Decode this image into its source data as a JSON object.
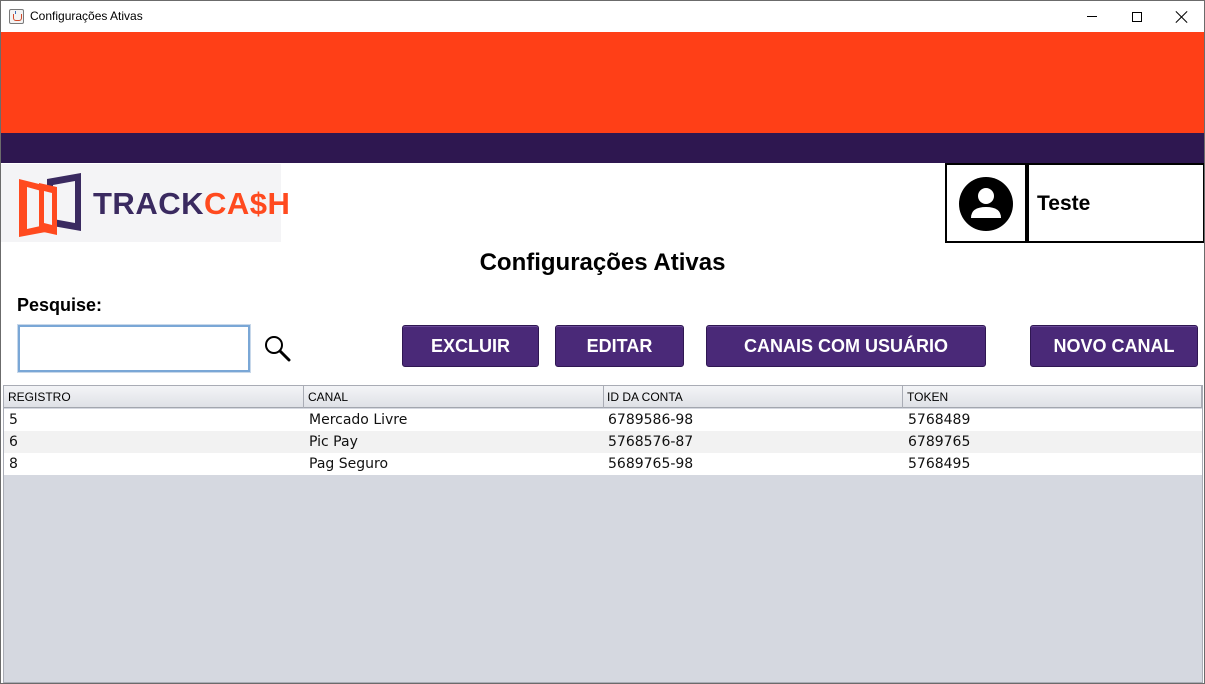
{
  "window": {
    "title": "Configurações Ativas"
  },
  "logo": {
    "text_track": "TRACK",
    "text_cash": "CA$H"
  },
  "user": {
    "name": "Teste"
  },
  "page": {
    "title": "Configurações Ativas"
  },
  "search": {
    "label": "Pesquise:",
    "value": ""
  },
  "toolbar": {
    "delete_label": "EXCLUIR",
    "edit_label": "EDITAR",
    "channels_label": "CANAIS COM USUÁRIO",
    "new_label": "NOVO CANAL"
  },
  "table": {
    "columns": [
      "REGISTRO",
      "CANAL",
      "ID DA CONTA",
      "TOKEN"
    ],
    "rows": [
      [
        "5",
        "Mercado Livre",
        "6789586-98",
        "5768489"
      ],
      [
        "6",
        "Pic Pay",
        "5768576-87",
        "6789765"
      ],
      [
        "8",
        "Pag Seguro",
        "5689765-98",
        "5768495"
      ]
    ]
  },
  "colors": {
    "banner_orange": "#ff3f17",
    "banner_purple": "#2e1750",
    "button": "#4a2978",
    "table_empty_area": "#d5d8e0"
  }
}
